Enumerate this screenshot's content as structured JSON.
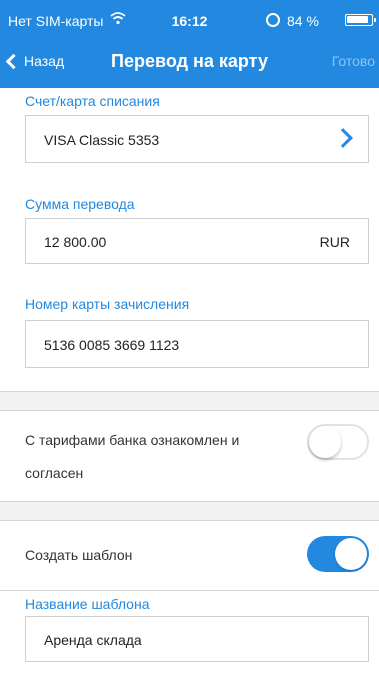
{
  "status_bar": {
    "carrier": "Нет SIM-карты",
    "time": "16:12",
    "battery": "84 %",
    "battery_level": 0.84
  },
  "nav": {
    "back_label": "Назад",
    "title": "Перевод на карту",
    "done_label": "Готово"
  },
  "form": {
    "source": {
      "label": "Счет/карта списания",
      "value": "VISA Classic 5353"
    },
    "amount": {
      "label": "Сумма перевода",
      "value": "12 800.00",
      "currency": "RUR"
    },
    "target_card": {
      "label": "Номер карты зачисления",
      "value": "5136 0085 3669 1123"
    },
    "tariffs_agree": {
      "text_line1": "С тарифами банка ознакомлен и",
      "text_line2": "согласен",
      "enabled": false
    },
    "create_template": {
      "text": "Создать шаблон",
      "enabled": true
    },
    "template_name": {
      "label": "Название шаблона",
      "value": "Аренда склада"
    }
  },
  "colors": {
    "accent": "#2288e0",
    "done_disabled": "#8cc4f2",
    "separator_band": "#f1f1f1",
    "border": "#cfcfcf"
  }
}
